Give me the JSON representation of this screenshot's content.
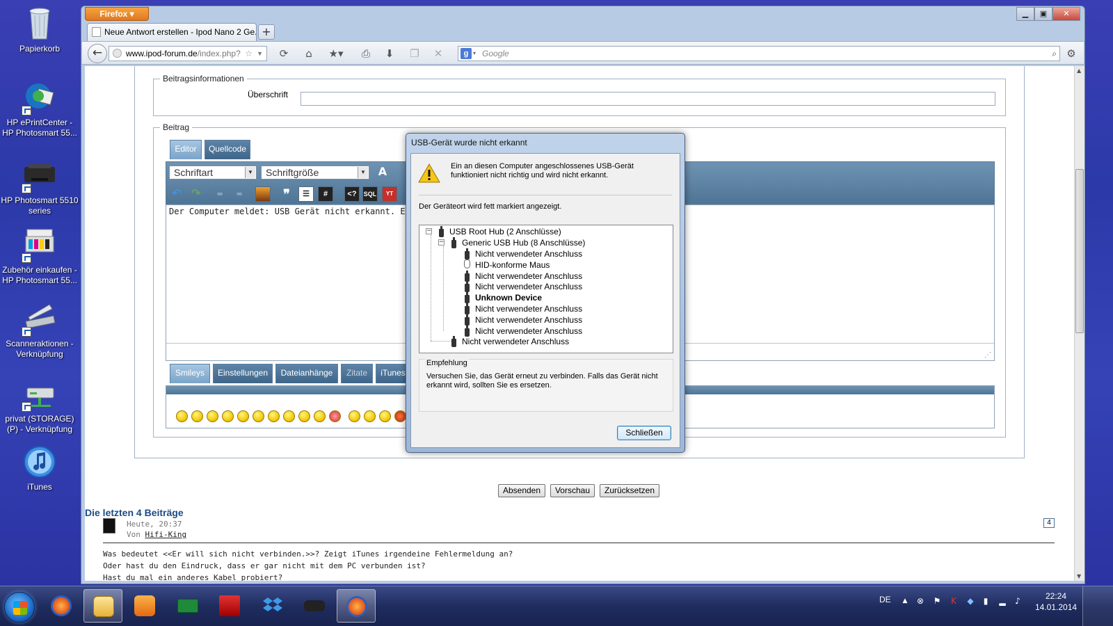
{
  "desktop": {
    "icons": [
      {
        "label": "Papierkorb"
      },
      {
        "label": "HP ePrintCenter - HP Photosmart 55..."
      },
      {
        "label": "HP Photosmart 5510 series"
      },
      {
        "label": "Zubehör einkaufen - HP Photosmart 55..."
      },
      {
        "label": "Scanneraktionen - Verknüpfung"
      },
      {
        "label": "privat (STORAGE) (P) - Verknüpfung"
      },
      {
        "label": "iTunes"
      }
    ]
  },
  "browser": {
    "menu_button": "Firefox",
    "tab_title": "Neue Antwort erstellen - Ipod Nano 2 Ge...",
    "new_tab": "+",
    "url_host": "www.ipod-forum.de",
    "url_path": "/index.php?",
    "search_placeholder": "Google",
    "search_engine_letter": "g"
  },
  "page": {
    "fieldset_info": "Beitragsinformationen",
    "subject_label": "Überschrift",
    "subject_value": "",
    "fieldset_post": "Beitrag",
    "editor_tabs": [
      "Editor",
      "Quellcode"
    ],
    "font_select": "Schriftart",
    "size_select": "Schriftgröße",
    "editor_text": "Der Computer meldet: USB Gerät nicht erkannt. Ein angeschl",
    "bottom_tabs": [
      "Smileys",
      "Einstellungen",
      "Dateianhänge",
      "Zitate",
      "iTunes"
    ],
    "buttons": [
      "Absenden",
      "Vorschau",
      "Zurücksetzen"
    ],
    "recent_heading": "Die letzten 4 Beiträge",
    "post": {
      "time": "Heute, 20:37",
      "by": "Von",
      "author": "Hifi-King",
      "number": "4",
      "lines": [
        "Was bedeutet <<Er will sich nicht verbinden.>>? Zeigt iTunes irgendeine Fehlermeldung an?",
        "Oder hast du den Eindruck, dass er gar nicht mit dem PC verbunden ist?",
        "Hast du mal ein anderes Kabel probiert?"
      ]
    }
  },
  "dialog": {
    "title": "USB-Gerät wurde nicht erkannt",
    "message": "Ein an diesen Computer angeschlossenes USB-Gerät funktioniert nicht richtig und wird nicht erkannt.",
    "hint": "Der Geräteort wird fett markiert angezeigt.",
    "tree": {
      "root": "USB Root Hub (2 Anschlüsse)",
      "hub": "Generic USB Hub (8 Anschlüsse)",
      "children": [
        "Nicht verwendeter Anschluss",
        "HID-konforme Maus",
        "Nicht verwendeter Anschluss",
        "Nicht verwendeter Anschluss",
        "Unknown Device",
        "Nicht verwendeter Anschluss",
        "Nicht verwendeter Anschluss",
        "Nicht verwendeter Anschluss"
      ],
      "root_child": "Nicht verwendeter Anschluss"
    },
    "recommend_title": "Empfehlung",
    "recommend_text": "Versuchen Sie, das Gerät erneut zu verbinden. Falls das Gerät nicht erkannt wird, sollten Sie es ersetzen.",
    "close_button": "Schließen"
  },
  "taskbar": {
    "language": "DE",
    "time": "22:24",
    "date": "14.01.2014"
  },
  "colors": {
    "firefox_orange": "#e0781f",
    "editor_blue": "#4f7596",
    "heading_blue": "#1b4b85"
  }
}
